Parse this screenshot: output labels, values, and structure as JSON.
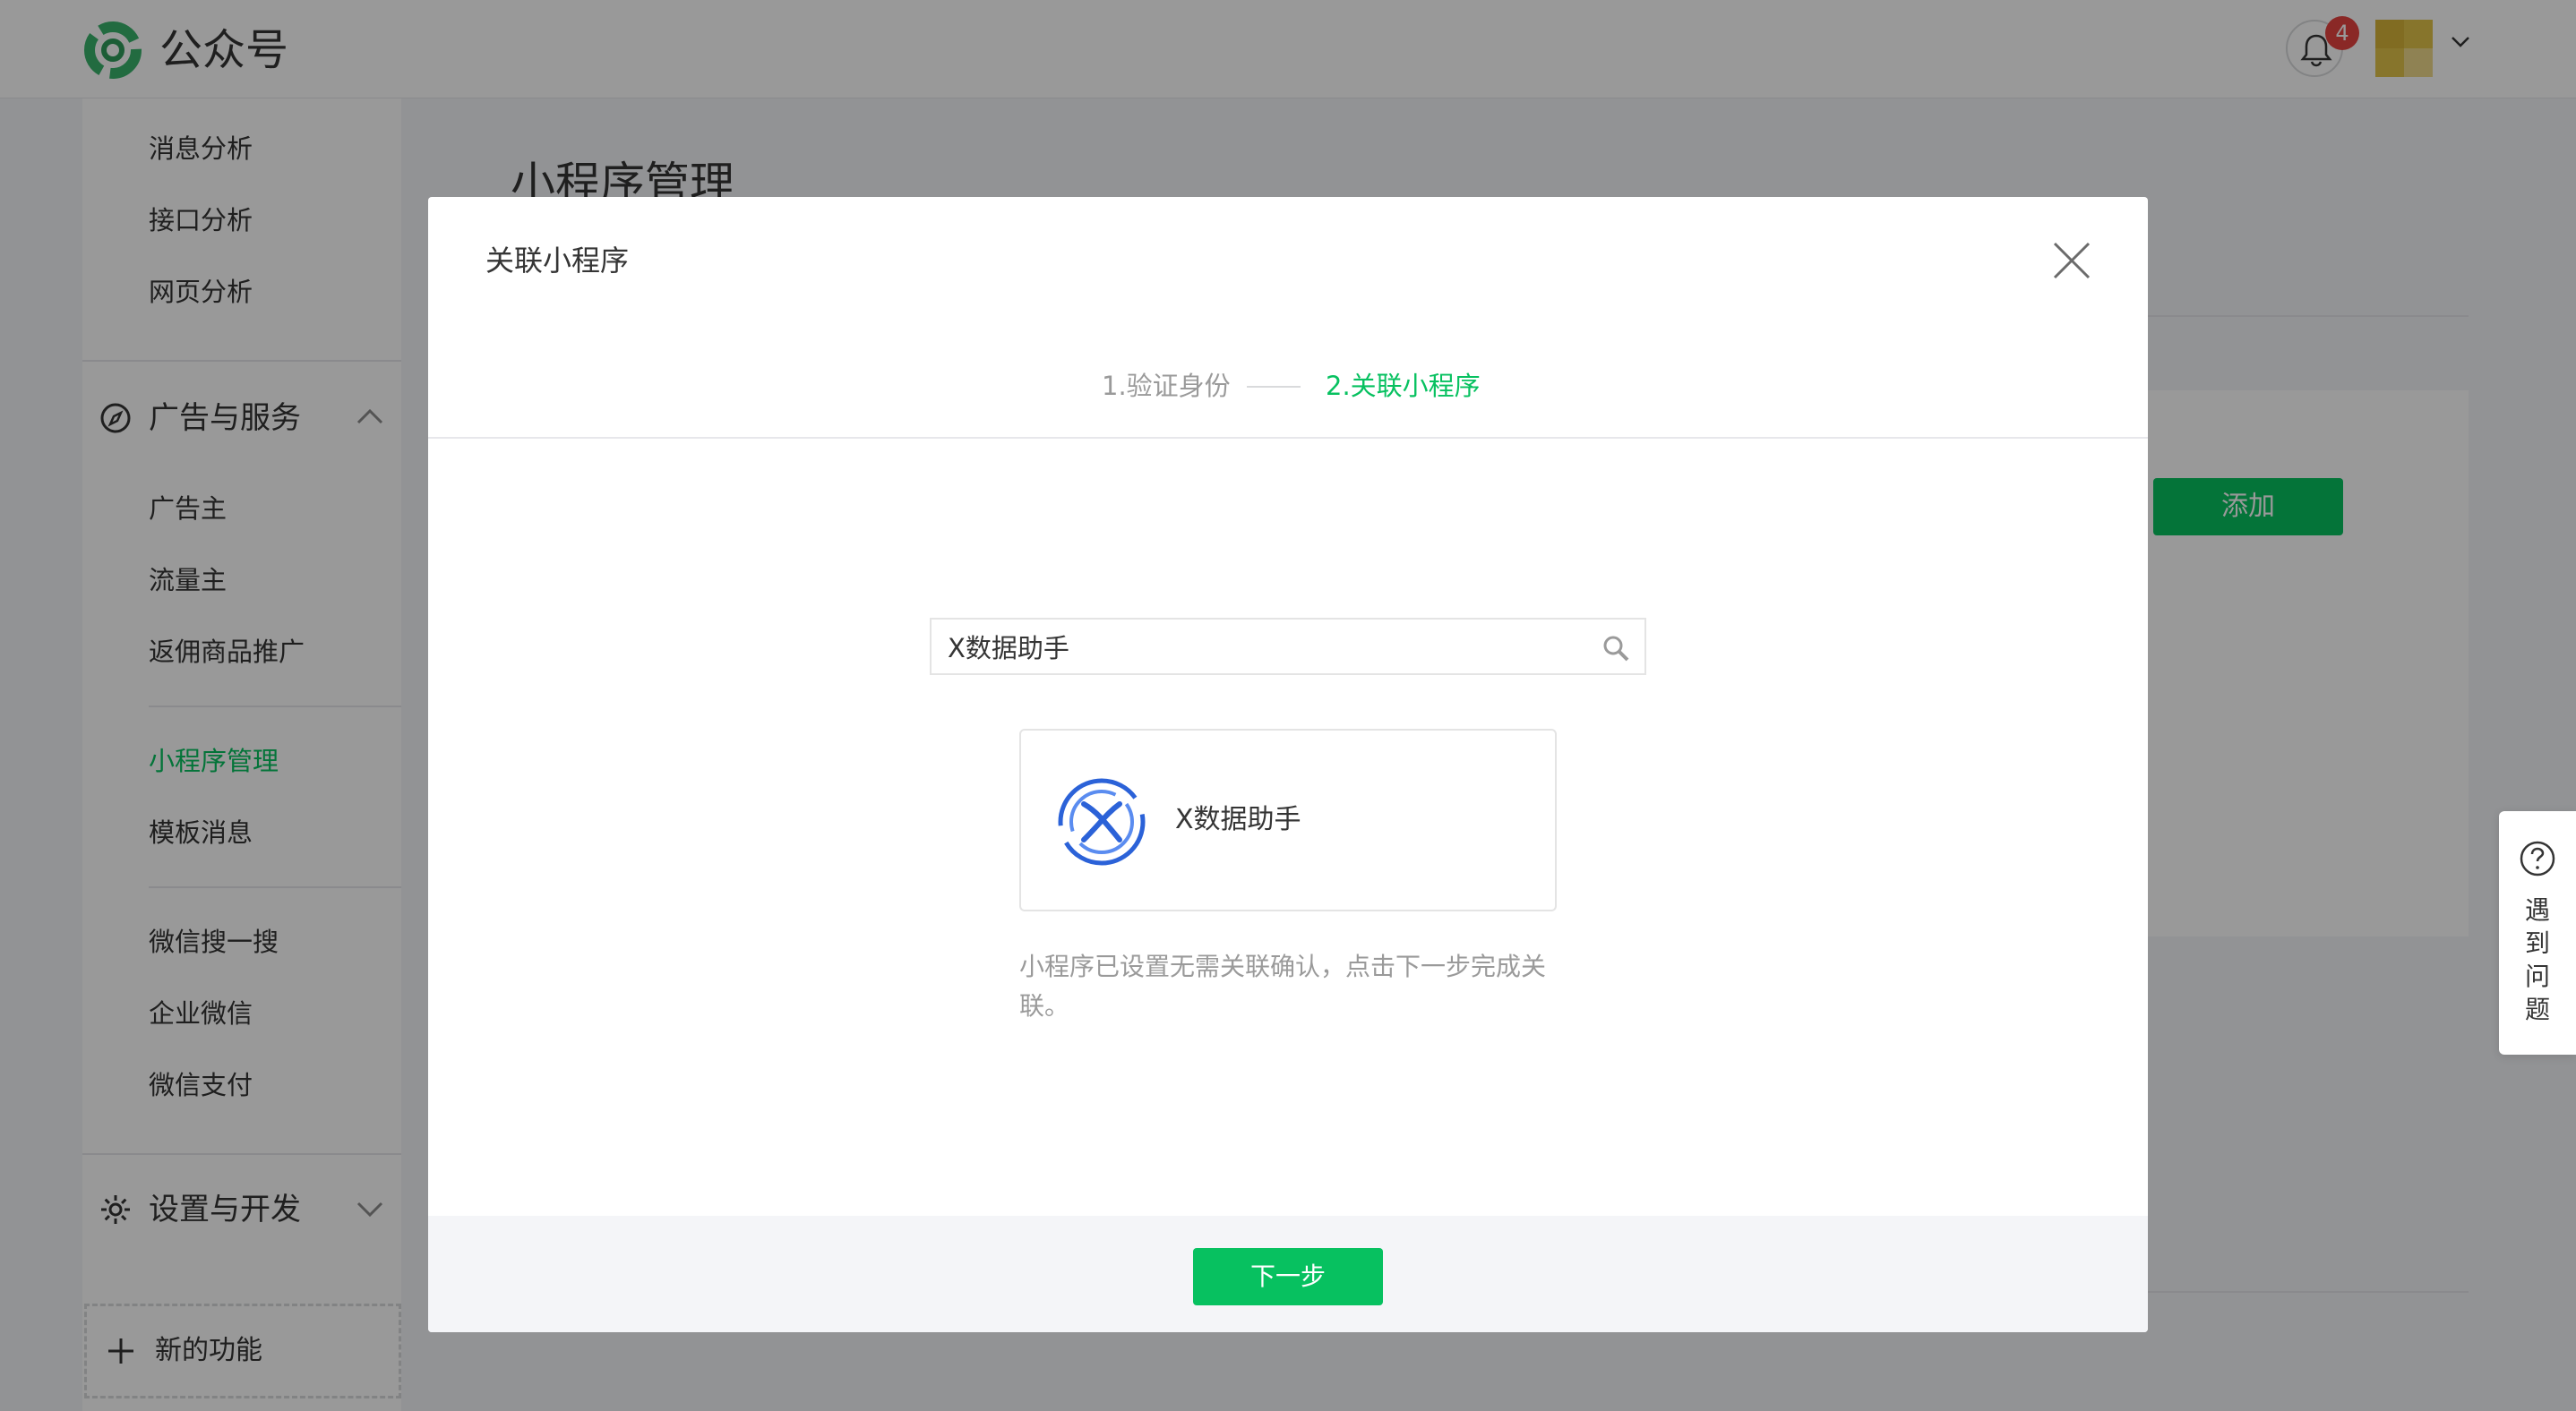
{
  "header": {
    "app_name": "公众号",
    "notification_count": "4"
  },
  "sidebar": {
    "analysis_items": [
      "消息分析",
      "接口分析",
      "网页分析"
    ],
    "ads_group": {
      "label": "广告与服务",
      "items": [
        "广告主",
        "流量主",
        "返佣商品推广"
      ]
    },
    "items_a": [
      "小程序管理",
      "模板消息"
    ],
    "items_b": [
      "微信搜一搜",
      "企业微信",
      "微信支付"
    ],
    "settings_group": {
      "label": "设置与开发"
    },
    "new_feature": "新的功能"
  },
  "main": {
    "page_title": "小程序管理",
    "add_button": "添加"
  },
  "help_widget": [
    "遇",
    "到",
    "问",
    "题"
  ],
  "dialog": {
    "title": "关联小程序",
    "steps": [
      "1.验证身份",
      "2.关联小程序"
    ],
    "search_value": "X数据助手",
    "result": {
      "name": "X数据助手"
    },
    "hint": "小程序已设置无需关联确认，点击下一步完成关联。",
    "next_button": "下一步"
  },
  "colors": {
    "accent": "#07c160",
    "badge": "#e64340",
    "overlay": "rgba(0,0,0,0.4)",
    "result_logo": "#2b62d8"
  }
}
